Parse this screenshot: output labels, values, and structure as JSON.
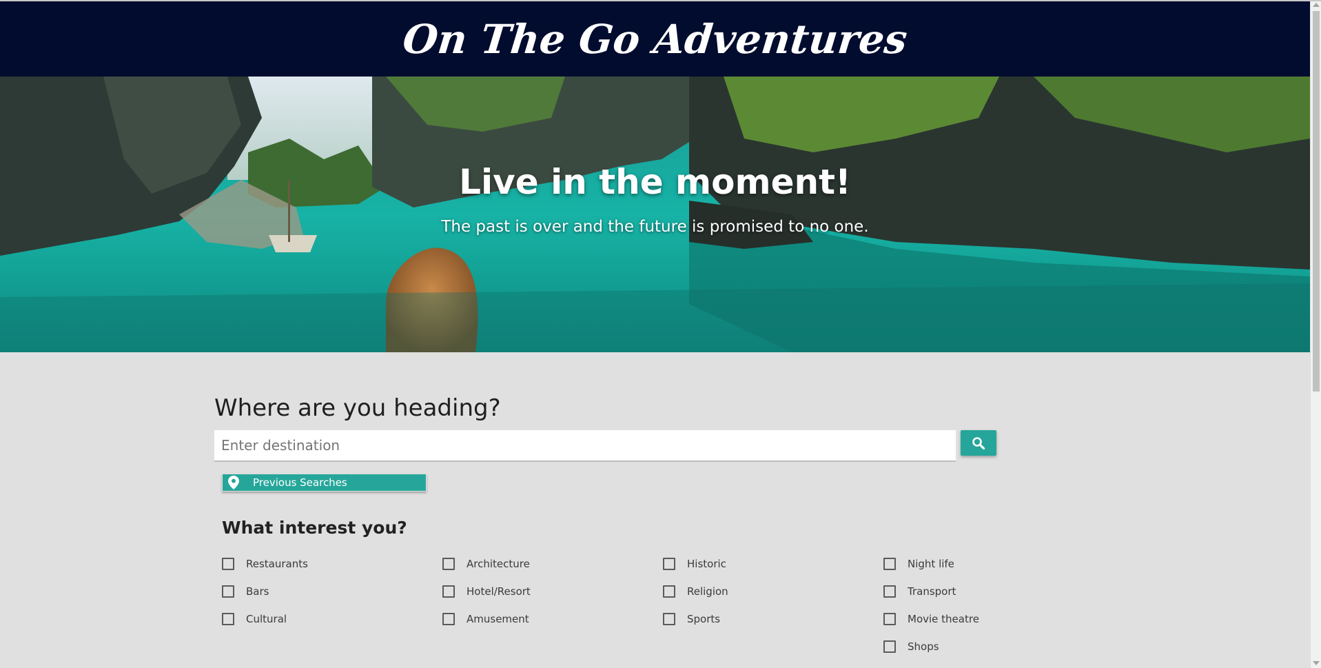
{
  "header": {
    "brand": "On The Go Adventures"
  },
  "hero": {
    "title": "Live in the moment!",
    "subtitle": "The past is over and the future is promised to no one."
  },
  "search": {
    "heading": "Where are you heading?",
    "placeholder": "Enter destination",
    "value": "",
    "search_icon": "search-icon",
    "previous_label": "Previous Searches",
    "previous_icon": "map-pin-icon"
  },
  "interests": {
    "heading": "What interest you?",
    "columns": [
      [
        "Restaurants",
        "Bars",
        "Cultural"
      ],
      [
        "Architecture",
        "Hotel/Resort",
        "Amusement"
      ],
      [
        "Historic",
        "Religion",
        "Sports"
      ],
      [
        "Night life",
        "Transport",
        "Movie theatre",
        "Shops"
      ]
    ]
  },
  "colors": {
    "header_bg": "#020c2e",
    "accent": "#26a69a",
    "page_bg": "#e0e0e0"
  }
}
